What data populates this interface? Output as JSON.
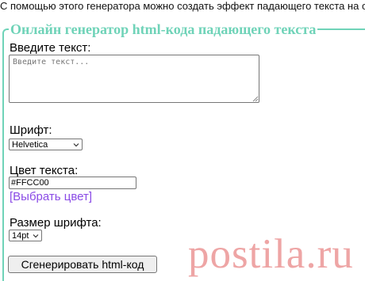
{
  "intro_text": "С помощью этого генератора можно создать эффект падающего текста на од",
  "form": {
    "legend": "Онлайн генератор html-кода падающего текста",
    "text_label": "Введите текст:",
    "text_placeholder": "Введите текст...",
    "font_label": "Шрифт:",
    "font_value": "Helvetica",
    "color_label": "Цвет текста:",
    "color_value": "#FFCC00",
    "pick_color_link": "[Выбрать цвет]",
    "size_label": "Размер шрифта:",
    "size_value": "14pt",
    "generate_button": "Сгенерировать html-код"
  },
  "watermark": "postila.ru",
  "colors": {
    "legend": "#6fd3b8",
    "link": "#8a4be6",
    "watermark": "#e88282"
  }
}
